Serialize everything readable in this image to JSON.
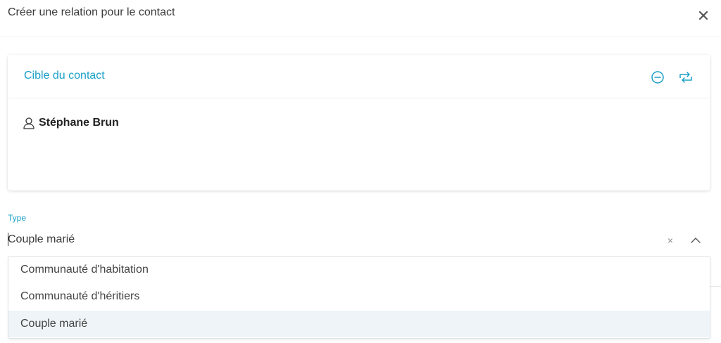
{
  "dialog": {
    "title": "Créer une relation pour le contact",
    "close_icon": "close-icon"
  },
  "target_card": {
    "title": "Cible du contact",
    "remove_icon": "minus-circle-icon",
    "swap_icon": "swap-icon",
    "contact": {
      "icon": "person-icon",
      "name": "Stéphane Brun"
    }
  },
  "type_field": {
    "label": "Type",
    "value": "Couple marié",
    "clear_symbol": "×",
    "chevron_icon": "chevron-up-icon"
  },
  "dropdown": {
    "options": [
      {
        "label": "Communauté d'habitation",
        "selected": false
      },
      {
        "label": "Communauté d'héritiers",
        "selected": false
      },
      {
        "label": "Couple marié",
        "selected": true
      }
    ]
  },
  "colors": {
    "accent": "#1aa0c8",
    "selected_bg": "#eef4f7"
  }
}
